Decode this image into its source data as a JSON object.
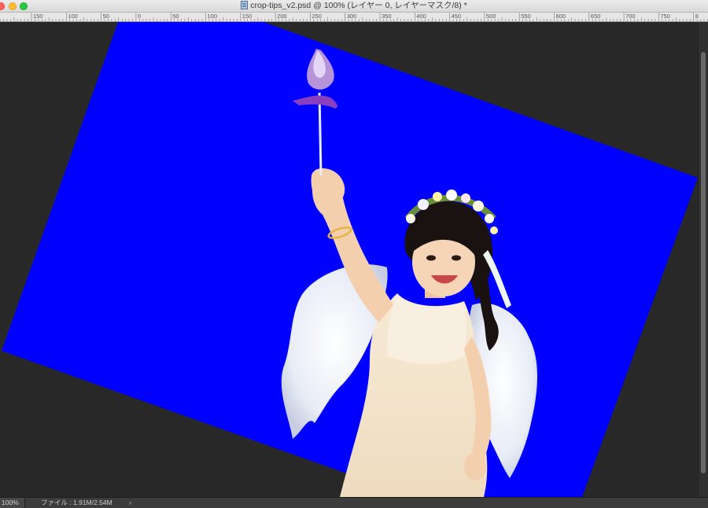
{
  "window": {
    "title": "crop-tips_v2.psd @ 100% (レイヤー 0, レイヤーマスク/8) *",
    "file_icon": "psd-file-icon"
  },
  "ruler": {
    "labels": [
      "150",
      "100",
      "50",
      "0",
      "50",
      "100",
      "150",
      "200",
      "250",
      "300",
      "350",
      "400",
      "450",
      "500",
      "550",
      "600",
      "650",
      "700",
      "750",
      "8"
    ]
  },
  "canvas": {
    "fill_color": "#0000ff",
    "background_color": "#282828",
    "rotation_degrees": 22,
    "photo_subject": "girl-with-angel-wings-and-wand"
  },
  "status": {
    "zoom": "100%",
    "doc_info": "ファイル : 1.91M/2.54M",
    "arrow": "›"
  },
  "colors": {
    "close": "#fe5f57",
    "minimize": "#febc2e",
    "maximize": "#28c840"
  }
}
